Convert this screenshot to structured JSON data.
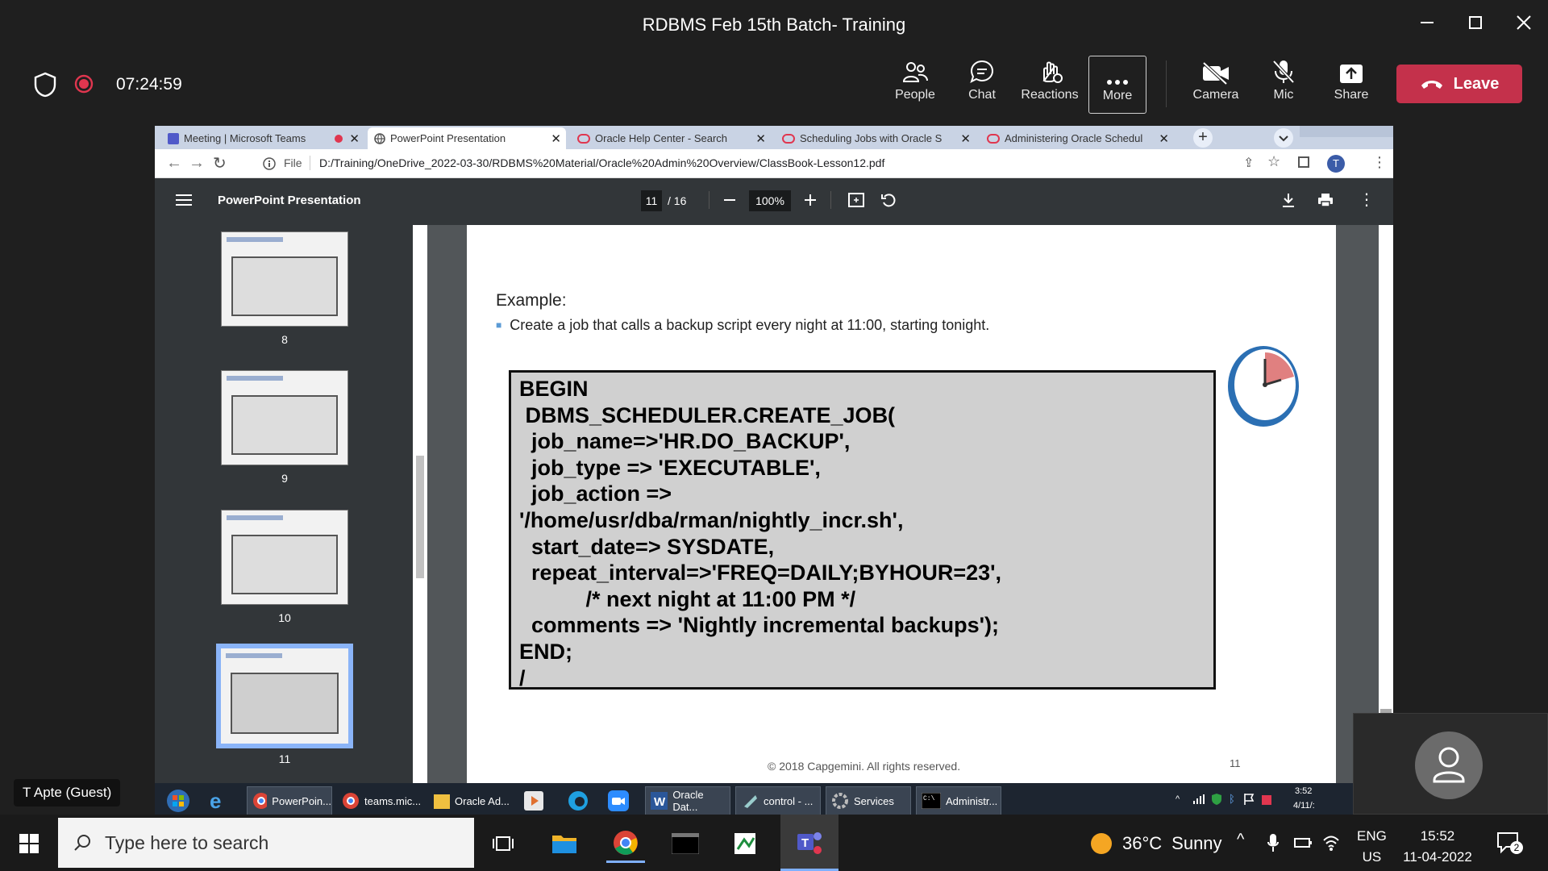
{
  "window": {
    "title": "RDBMS Feb 15th Batch- Training"
  },
  "meeting": {
    "timer": "07:24:59",
    "buttons": [
      {
        "label": "People",
        "icon": "people-icon"
      },
      {
        "label": "Chat",
        "icon": "chat-icon"
      },
      {
        "label": "Reactions",
        "icon": "reactions-icon"
      },
      {
        "label": "More",
        "icon": "more-icon"
      },
      {
        "label": "Camera",
        "icon": "camera-off-icon"
      },
      {
        "label": "Mic",
        "icon": "mic-off-icon"
      },
      {
        "label": "Share",
        "icon": "share-icon"
      }
    ],
    "leave_label": "Leave",
    "guest_label": "T Apte (Guest)",
    "leave_color": "#c4314b"
  },
  "browser": {
    "tabs": [
      {
        "label": "Meeting | Microsoft Teams"
      },
      {
        "label": "PowerPoint Presentation"
      },
      {
        "label": "Oracle Help Center - Search"
      },
      {
        "label": "Scheduling Jobs with Oracle S"
      },
      {
        "label": "Administering Oracle Schedul"
      }
    ],
    "url_scheme": "File",
    "url": "D:/Training/OneDrive_2022-03-30/RDBMS%20Material/Oracle%20Admin%20Overview/ClassBook-Lesson12.pdf",
    "profile_initial": "T"
  },
  "pdf": {
    "title": "PowerPoint Presentation",
    "page": "11",
    "total": "/ 16",
    "zoom": "100%",
    "thumbnails": [
      "8",
      "9",
      "10",
      "11"
    ]
  },
  "slide": {
    "example_title": "Example:",
    "bullet": "Create a job that calls a backup script every night at 11:00, starting tonight.",
    "code": "BEGIN\n DBMS_SCHEDULER.CREATE_JOB(\n  job_name=>'HR.DO_BACKUP',\n  job_type => 'EXECUTABLE',\n  job_action =>\n'/home/usr/dba/rman/nightly_incr.sh',\n  start_date=> SYSDATE,\n  repeat_interval=>'FREQ=DAILY;BYHOUR=23',\n           /* next night at 11:00 PM */\n  comments => 'Nightly incremental backups');\nEND;\n/",
    "footer": "© 2018 Capgemini. All rights reserved.",
    "page_number": "11"
  },
  "inner_taskbar": {
    "items": [
      "PowerPoin...",
      "teams.mic...",
      "Oracle Ad...",
      "Oracle Dat...",
      "control - ...",
      "Services",
      "Administr..."
    ],
    "time": "3:52",
    "date": "4/11/:"
  },
  "taskbar": {
    "search_placeholder": "Type here to search",
    "weather_temp": "36°C",
    "weather_text": "Sunny",
    "lang_1": "ENG",
    "lang_2": "US",
    "time": "15:52",
    "date": "11-04-2022",
    "notification_count": "2"
  }
}
